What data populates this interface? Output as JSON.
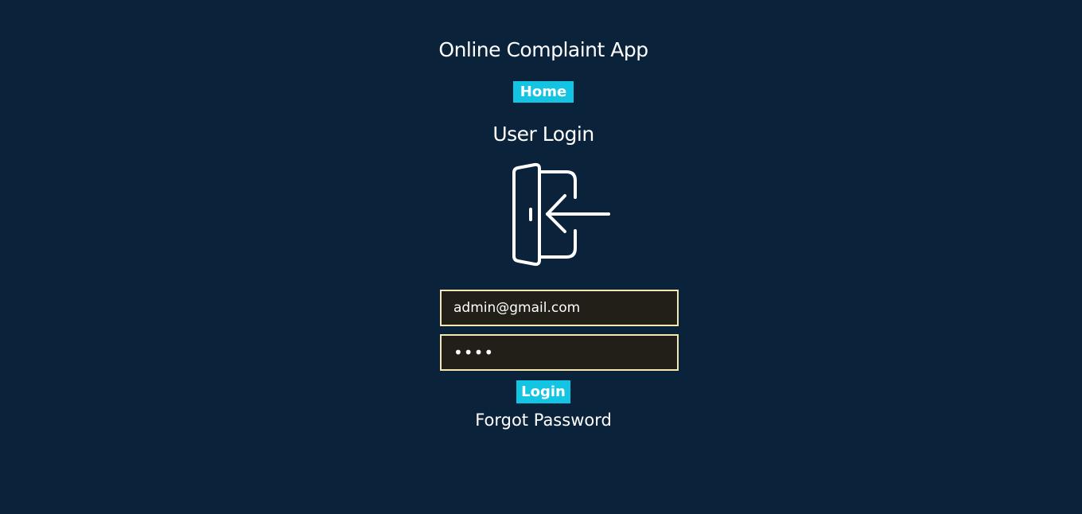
{
  "app": {
    "title": "Online Complaint App"
  },
  "nav": {
    "home_label": "Home"
  },
  "login": {
    "title": "User Login",
    "icon": "login-door-arrow-icon",
    "email_value": "admin@gmail.com",
    "password_value": "1234",
    "submit_label": "Login",
    "forgot_label": "Forgot Password"
  },
  "colors": {
    "background": "#0b223b",
    "accent": "#14c5e3",
    "input_bg": "#221e18",
    "input_border": "#f4e7b0"
  }
}
